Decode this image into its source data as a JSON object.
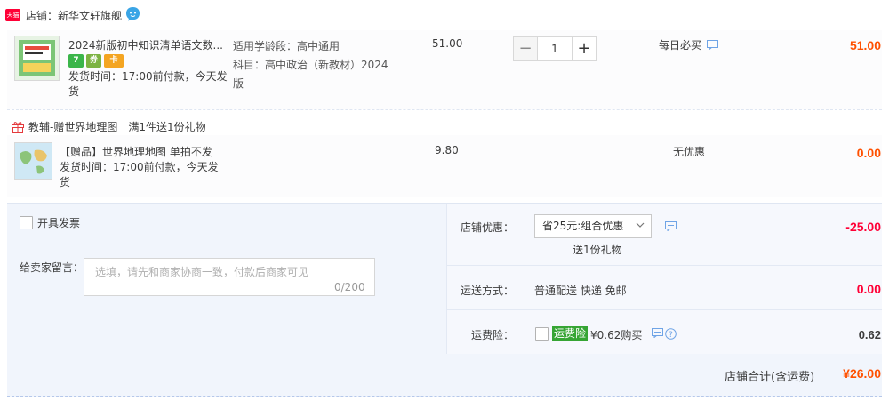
{
  "shop": {
    "badge": "天猫",
    "name": "店铺：新华文轩旗舰",
    "brand_color": "#ff0036",
    "icon": "wangwang-chat-icon"
  },
  "item": {
    "title": "2024新版初中知识清单语文数...",
    "tags": [
      "7",
      "券",
      "卡"
    ],
    "ship_time": "发货时间：17:00前付款，今天发货",
    "attr_stage": "适用学龄段：高中通用",
    "attr_subject": "科目：高中政治（新教材）2024版",
    "unit_price": "51.00",
    "quantity": "1",
    "promo": "每日必买",
    "subtotal": "51.00"
  },
  "gift": {
    "header": "教辅-赠世界地理图",
    "rule": "满1件送1份礼物",
    "title": "【赠品】世界地理地图 单拍不发",
    "ship_time": "发货时间：17:00前付款，今天发货",
    "unit_price": "9.80",
    "promo": "无优惠",
    "subtotal": "0.00"
  },
  "order": {
    "invoice_label": "开具发票",
    "message_label": "给卖家留言：",
    "message_placeholder": "选填，请先和商家协商一致，付款后商家可见",
    "message_count": "0/200",
    "discount_label": "店铺优惠：",
    "discount_option": "省25元:组合优惠",
    "discount_gift_note": "送1份礼物",
    "discount_amount": "-25.00",
    "shipping_label": "运送方式：",
    "shipping_method": "普通配送 快递 免邮",
    "shipping_amount": "0.00",
    "insurance_label": "运费险：",
    "insurance_tag": "运费险",
    "insurance_text": "¥0.62购买",
    "insurance_amount": "0.62",
    "total_label": "店铺合计(含运费)",
    "total_amount": "¥26.00"
  },
  "colors": {
    "price_orange": "#ff5000",
    "discount_red": "#ff0036",
    "insurance_green": "#36a534",
    "summary_bg": "#f1f5fc"
  }
}
